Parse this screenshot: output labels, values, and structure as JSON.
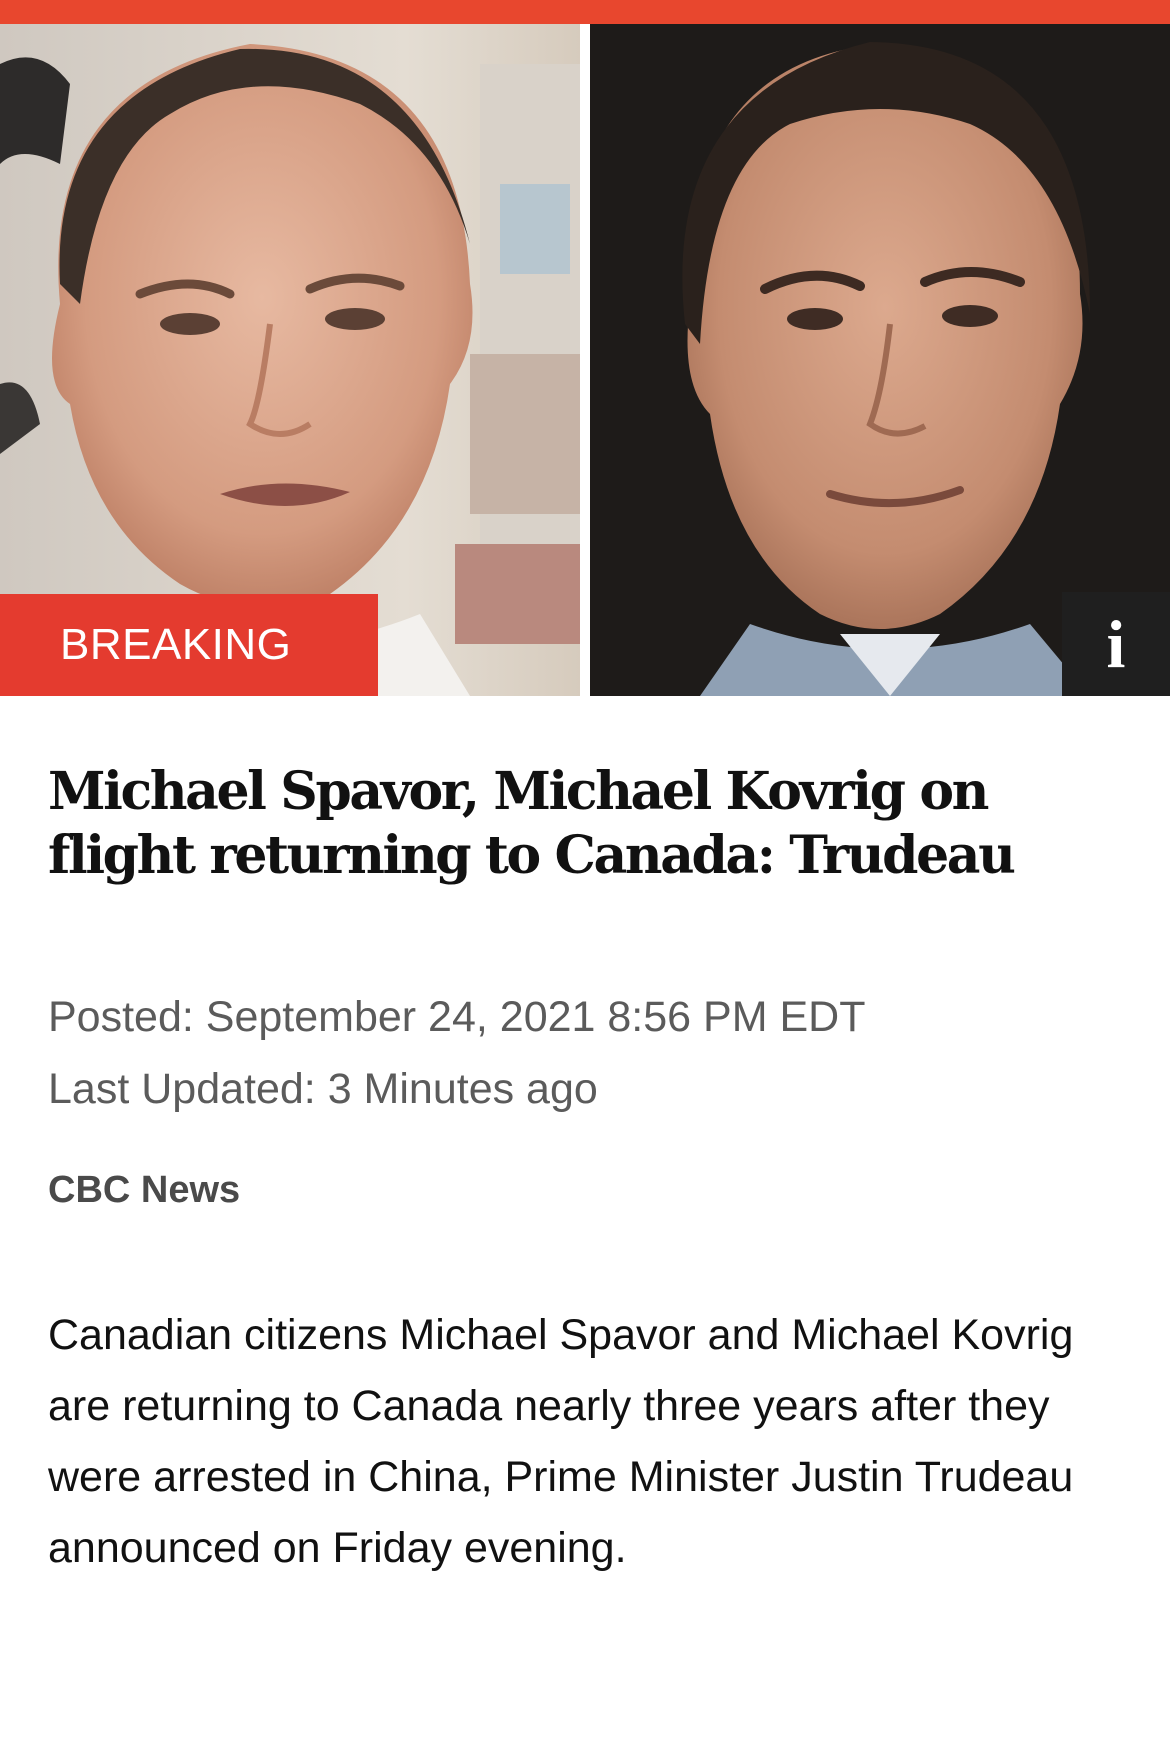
{
  "article": {
    "badge": "BREAKING",
    "info_label": "i",
    "headline": "Michael Spavor, Michael Kovrig on flight returning to Canada: Trudeau",
    "posted": "Posted: September 24, 2021 8:56 PM EDT",
    "last_updated": "Last Updated: 3 Minutes ago",
    "source": "CBC News",
    "body": "Canadian citizens Michael Spavor and Michael Kovrig are returning to Canada nearly three years after they were arrested in China, Prime Minister Justin Trudeau announced on Friday evening."
  },
  "colors": {
    "accent_bar": "#e8472e",
    "breaking_badge": "#e43b2f",
    "info_button": "#1f1f1f",
    "meta_text": "#5b5b5b"
  },
  "icons": {
    "info": "info-icon"
  }
}
